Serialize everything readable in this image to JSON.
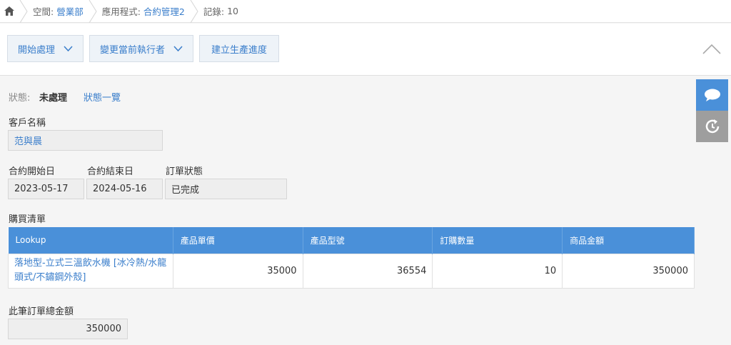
{
  "breadcrumb": {
    "space_label": "空間:",
    "space_value": "營業部",
    "app_label": "應用程式:",
    "app_value": "合約管理2",
    "record_label": "記錄:",
    "record_value": "10"
  },
  "toolbar": {
    "start_process": "開始處理",
    "change_assignee": "變更當前執行者",
    "create_progress": "建立生產進度"
  },
  "status": {
    "label": "狀態:",
    "value": "未處理",
    "link": "狀態一覽"
  },
  "form": {
    "customer_label": "客戶名稱",
    "customer_value": "范與晨",
    "start_date_label": "合約開始日",
    "start_date_value": "2023-05-17",
    "end_date_label": "合約結束日",
    "end_date_value": "2024-05-16",
    "order_status_label": "訂單狀態",
    "order_status_value": "已完成",
    "purchase_list_label": "購買清單",
    "total_label": "此筆訂單總金額",
    "total_value": "350000"
  },
  "table": {
    "headers": [
      "Lookup",
      "產品單價",
      "產品型號",
      "訂購數量",
      "商品金額"
    ],
    "rows": [
      {
        "lookup": "落地型-立式三溫飲水機 [冰冷熱/水龍頭式/不鏽鋼外殼]",
        "price": "35000",
        "model": "36554",
        "qty": "10",
        "amount": "350000"
      }
    ]
  },
  "colors": {
    "accent": "#4a90d9",
    "link": "#3a7ecb"
  },
  "icons": [
    "home-icon",
    "chevron-down-icon",
    "collapse-up-icon",
    "comment-icon",
    "history-icon"
  ]
}
